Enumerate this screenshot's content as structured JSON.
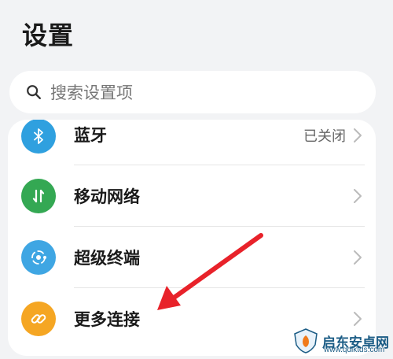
{
  "header": {
    "title": "设置"
  },
  "search": {
    "placeholder": "搜索设置项",
    "icon": "search-icon"
  },
  "settings": {
    "items": [
      {
        "label": "蓝牙",
        "value": "已关闭",
        "icon": "bluetooth-icon",
        "color": "#2fa0df"
      },
      {
        "label": "移动网络",
        "value": "",
        "icon": "mobile-data-icon",
        "color": "#34a853"
      },
      {
        "label": "超级终端",
        "value": "",
        "icon": "super-device-icon",
        "color": "#3fa6e3"
      },
      {
        "label": "更多连接",
        "value": "",
        "icon": "link-icon",
        "color": "#f5a623"
      }
    ]
  },
  "annotation": {
    "arrow_color": "#e8222a"
  },
  "watermark": {
    "text": "启东安卓网",
    "url": "www.qdlktds.com"
  }
}
